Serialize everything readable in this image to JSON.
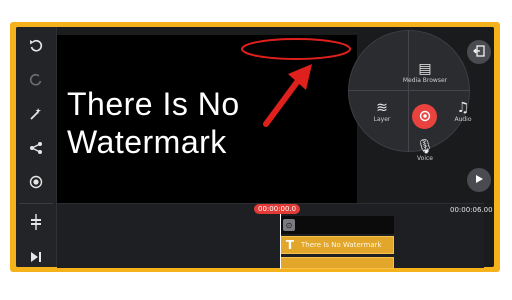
{
  "left_toolbar": {
    "items": [
      {
        "name": "undo",
        "icon": "undo-icon",
        "glyph": "↺"
      },
      {
        "name": "redo",
        "icon": "redo-icon",
        "glyph": "↻"
      },
      {
        "name": "effects",
        "icon": "magic-wand-icon",
        "glyph": "✧"
      },
      {
        "name": "share",
        "icon": "share-icon",
        "glyph": "⋖"
      },
      {
        "name": "record",
        "icon": "record-circle-icon",
        "glyph": "◉"
      },
      {
        "name": "adjust",
        "icon": "timeline-adjust-icon",
        "glyph": "╪"
      },
      {
        "name": "skip-end",
        "icon": "skip-end-icon",
        "glyph": "▶|"
      }
    ]
  },
  "preview": {
    "overlay_text": "There Is No Watermark"
  },
  "media_wheel": {
    "top_label": "Media Browser",
    "left_label": "Layer",
    "right_label": "Audio",
    "bottom_label": "Voice"
  },
  "timeline": {
    "current_time": "00:00:00.0",
    "end_time": "00:00:06.00",
    "layer_track_label": "There Is No Watermark"
  },
  "colors": {
    "frame": "#f5b21a",
    "accent_red": "#e03b37",
    "layer_yellow": "#e2a62b"
  }
}
